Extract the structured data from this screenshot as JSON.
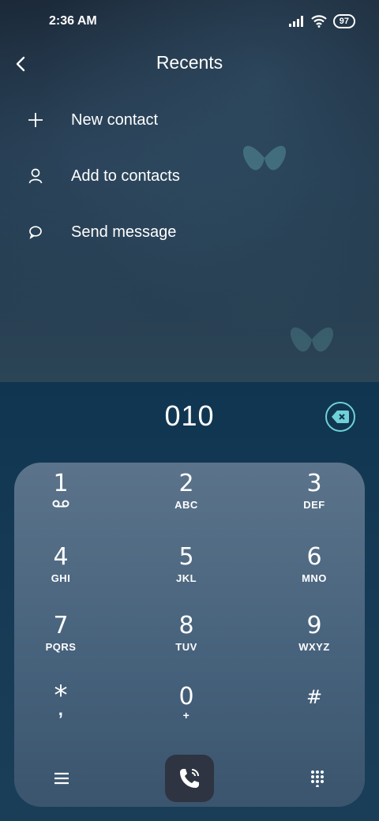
{
  "status_bar": {
    "time": "2:36 AM",
    "battery": "97"
  },
  "header": {
    "title": "Recents"
  },
  "menu": [
    {
      "label": "New contact",
      "icon": "plus-icon"
    },
    {
      "label": "Add to contacts",
      "icon": "person-icon"
    },
    {
      "label": "Send message",
      "icon": "message-icon"
    }
  ],
  "dialer": {
    "number": "010",
    "keys": [
      {
        "digit": "1",
        "letters": ""
      },
      {
        "digit": "2",
        "letters": "ABC"
      },
      {
        "digit": "3",
        "letters": "DEF"
      },
      {
        "digit": "4",
        "letters": "GHI"
      },
      {
        "digit": "5",
        "letters": "JKL"
      },
      {
        "digit": "6",
        "letters": "MNO"
      },
      {
        "digit": "7",
        "letters": "PQRS"
      },
      {
        "digit": "8",
        "letters": "TUV"
      },
      {
        "digit": "9",
        "letters": "WXYZ"
      },
      {
        "digit": "*",
        "letters": ","
      },
      {
        "digit": "0",
        "letters": "+"
      },
      {
        "digit": "#",
        "letters": ""
      }
    ]
  },
  "colors": {
    "accent": "#6fd0d8",
    "call_button": "#2e3441"
  }
}
